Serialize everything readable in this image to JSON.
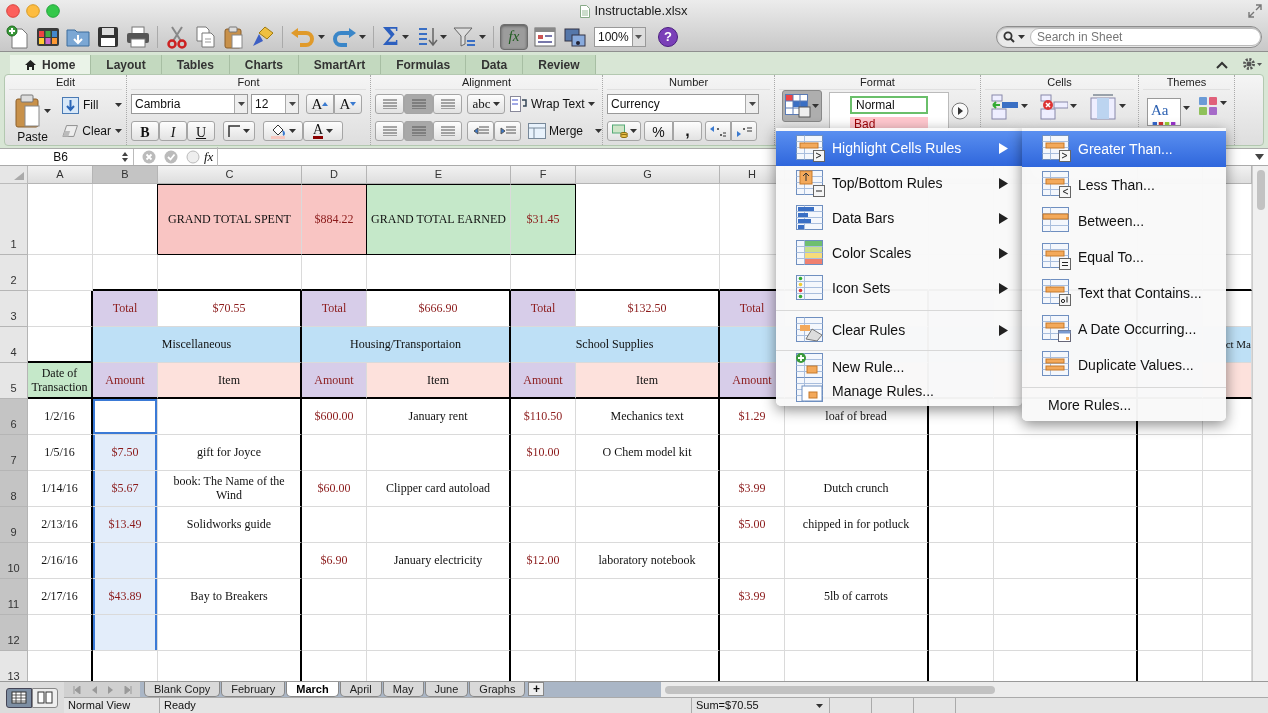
{
  "window": {
    "title": "Instructable.xlsx"
  },
  "toolbar": {
    "autosum": "Σ",
    "formula_builder": {
      "label": "fx",
      "pressed": true
    },
    "zoom": "100%",
    "help": "?",
    "search": {
      "placeholder": "Search in Sheet"
    }
  },
  "ribbon": {
    "tabs": [
      {
        "label": "Home",
        "selected": true
      },
      {
        "label": "Layout",
        "selected": false
      },
      {
        "label": "Tables",
        "selected": false
      },
      {
        "label": "Charts",
        "selected": false
      },
      {
        "label": "SmartArt",
        "selected": false
      },
      {
        "label": "Formulas",
        "selected": false
      },
      {
        "label": "Data",
        "selected": false
      },
      {
        "label": "Review",
        "selected": false
      }
    ],
    "edit": {
      "title": "Edit",
      "paste": "Paste",
      "fill": "Fill",
      "clear": "Clear"
    },
    "font": {
      "title": "Font",
      "family": "Cambria",
      "size": "12",
      "grow": "A",
      "shrink": "A",
      "bold": "B",
      "italic": "I",
      "underline": "U",
      "font_color_button": "A"
    },
    "alignment": {
      "title": "Alignment",
      "orientation": "abc",
      "wrap": "Wrap Text",
      "merge": "Merge"
    },
    "number": {
      "title": "Number",
      "format": "Currency",
      "percent": "%",
      "comma": ","
    },
    "format": {
      "title": "Format",
      "styles": [
        "Normal",
        "Bad"
      ]
    },
    "cells": {
      "title": "Cells"
    },
    "themes": {
      "title": "Themes",
      "theme": "Aa"
    }
  },
  "formula_bar": {
    "name_box": "B6",
    "fx": "fx"
  },
  "sheet": {
    "columns": [
      {
        "label": "A",
        "selected": false
      },
      {
        "label": "B",
        "selected": true
      },
      {
        "label": "C",
        "selected": false
      },
      {
        "label": "D",
        "selected": false
      },
      {
        "label": "E",
        "selected": false
      },
      {
        "label": "F",
        "selected": false
      },
      {
        "label": "G",
        "selected": false
      },
      {
        "label": "H",
        "selected": false
      }
    ],
    "rows": [
      {
        "row": "1",
        "selected": false,
        "cells": [
          "",
          "",
          "GRAND TOTAL SPENT",
          "$884.22",
          "GRAND TOTAL EARNED",
          "$31.45"
        ]
      },
      {
        "row": "2",
        "selected": false
      },
      {
        "row": "3",
        "selected": false,
        "cells": [
          "",
          "Total",
          "$70.55",
          "Total",
          "$666.90",
          "Total",
          "$132.50",
          "Total"
        ]
      },
      {
        "row": "4",
        "selected": false,
        "cells": [
          "",
          "Miscellaneous",
          "",
          "Housing/Transportaion",
          "",
          "School Supplies",
          "",
          "",
          "",
          "",
          "",
          "",
          "ct Ma"
        ]
      },
      {
        "row": "5",
        "selected": false,
        "cells": [
          "Date of Transaction",
          "Amount",
          "Item",
          "Amount",
          "Item",
          "Amount",
          "Item",
          "Amount"
        ]
      },
      {
        "row": "6",
        "selected": true,
        "cells": [
          "1/2/16",
          "",
          "",
          "$600.00",
          "January rent",
          "$110.50",
          "Mechanics text",
          "$1.29",
          "loaf of bread"
        ]
      },
      {
        "row": "7",
        "selected": true,
        "cells": [
          "1/5/16",
          "$7.50",
          "gift for Joyce",
          "",
          "",
          "$10.00",
          "O Chem model kit"
        ]
      },
      {
        "row": "8",
        "selected": true,
        "cells": [
          "1/14/16",
          "$5.67",
          "book: The Name of the Wind",
          "$60.00",
          "Clipper card autoload",
          "",
          "",
          "$3.99",
          "Dutch crunch"
        ]
      },
      {
        "row": "9",
        "selected": true,
        "cells": [
          "2/13/16",
          "$13.49",
          "Solidworks guide",
          "",
          "",
          "",
          "",
          "$5.00",
          "chipped in for potluck"
        ]
      },
      {
        "row": "10",
        "selected": true,
        "cells": [
          "2/16/16",
          "",
          "",
          "$6.90",
          "January electricity",
          "$12.00",
          "laboratory notebook"
        ]
      },
      {
        "row": "11",
        "selected": true,
        "cells": [
          "2/17/16",
          "$43.89",
          "Bay to Breakers",
          "",
          "",
          "",
          "",
          "$3.99",
          "5lb of carrots"
        ]
      },
      {
        "row": "12",
        "selected": true
      },
      {
        "row": "13",
        "selected": false
      }
    ]
  },
  "conditional_formatting_menu": {
    "sections": [
      {
        "items": [
          {
            "label": "Highlight Cells Rules",
            "submenu": true,
            "selected": true
          },
          {
            "label": "Top/Bottom Rules",
            "submenu": true,
            "selected": false
          },
          {
            "label": "Data Bars",
            "submenu": true,
            "selected": false
          },
          {
            "label": "Color Scales",
            "submenu": true,
            "selected": false
          },
          {
            "label": "Icon Sets",
            "submenu": true,
            "selected": false
          }
        ]
      },
      {
        "items": [
          {
            "label": "Clear Rules",
            "submenu": true,
            "selected": false
          }
        ]
      },
      {
        "items": [
          {
            "label": "New Rule...",
            "submenu": false,
            "selected": false
          },
          {
            "label": "Manage Rules...",
            "submenu": false,
            "selected": false
          }
        ]
      }
    ]
  },
  "highlight_cells_submenu": {
    "sections": [
      {
        "items": [
          {
            "label": "Greater Than...",
            "selected": true
          },
          {
            "label": "Less Than...",
            "selected": false
          },
          {
            "label": "Between...",
            "selected": false
          },
          {
            "label": "Equal To...",
            "selected": false
          },
          {
            "label": "Text that Contains...",
            "selected": false
          },
          {
            "label": "A Date Occurring...",
            "selected": false
          },
          {
            "label": "Duplicate Values...",
            "selected": false
          }
        ]
      },
      {
        "items": [
          {
            "label": "More Rules...",
            "selected": false
          }
        ]
      }
    ]
  },
  "sheet_tabs": {
    "views": [
      {
        "selected": true
      },
      {
        "selected": false
      }
    ],
    "tabs": [
      {
        "label": "Blank Copy",
        "selected": false
      },
      {
        "label": "February",
        "selected": false
      },
      {
        "label": "March",
        "selected": true
      },
      {
        "label": "April",
        "selected": false
      },
      {
        "label": "May",
        "selected": false
      },
      {
        "label": "June",
        "selected": false
      },
      {
        "label": "Graphs",
        "selected": false
      }
    ],
    "add": "+"
  },
  "status_bar": {
    "view": "Normal View",
    "status": "Ready",
    "sum": "Sum=$70.55"
  }
}
